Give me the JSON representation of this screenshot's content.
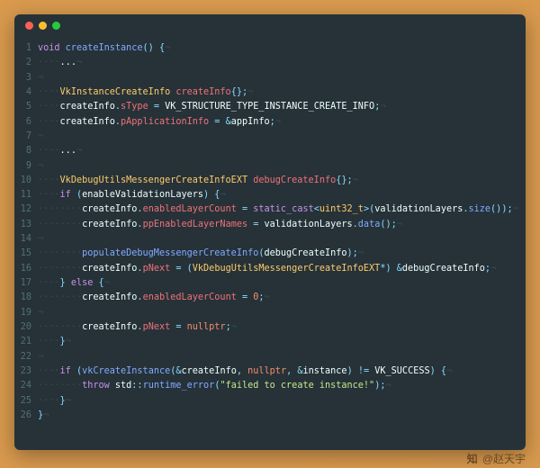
{
  "traffic_lights": {
    "red": "#ff5f56",
    "yellow": "#ffbd2e",
    "green": "#27c93f"
  },
  "code_bg": "#263238",
  "syntax": {
    "keyword": "#c792ea",
    "type": "#ffcb6b",
    "ident": "#eeffff",
    "func": "#82aaff",
    "param": "#f07178",
    "string": "#c3e88d",
    "number": "#f78c6c",
    "punct": "#89ddff",
    "op": "#89ddff",
    "const": "#eeffff",
    "null": "#f78c6c",
    "comment": "#546e7a",
    "invis": "#3a4a52"
  },
  "show_whitespace_dots": true,
  "show_eol_marker": true,
  "eol_marker": "¬",
  "dot_char": "·",
  "lines": [
    {
      "n": 1,
      "indent": 0,
      "tokens": [
        {
          "t": "void ",
          "c": "keyword"
        },
        {
          "t": "createInstance",
          "c": "func"
        },
        {
          "t": "() {",
          "c": "punct"
        }
      ]
    },
    {
      "n": 2,
      "indent": 1,
      "tokens": [
        {
          "t": "...",
          "c": "ident"
        }
      ]
    },
    {
      "n": 3,
      "indent": 0,
      "tokens": []
    },
    {
      "n": 4,
      "indent": 1,
      "tokens": [
        {
          "t": "VkInstanceCreateInfo ",
          "c": "type"
        },
        {
          "t": "createInfo",
          "c": "param"
        },
        {
          "t": "{};",
          "c": "punct"
        }
      ]
    },
    {
      "n": 5,
      "indent": 1,
      "tokens": [
        {
          "t": "createInfo",
          "c": "ident"
        },
        {
          "t": ".",
          "c": "punct"
        },
        {
          "t": "sType",
          "c": "param"
        },
        {
          "t": " = ",
          "c": "op"
        },
        {
          "t": "VK_STRUCTURE_TYPE_INSTANCE_CREATE_INFO",
          "c": "const"
        },
        {
          "t": ";",
          "c": "punct"
        }
      ]
    },
    {
      "n": 6,
      "indent": 1,
      "tokens": [
        {
          "t": "createInfo",
          "c": "ident"
        },
        {
          "t": ".",
          "c": "punct"
        },
        {
          "t": "pApplicationInfo",
          "c": "param"
        },
        {
          "t": " = ",
          "c": "op"
        },
        {
          "t": "&",
          "c": "op"
        },
        {
          "t": "appInfo",
          "c": "ident"
        },
        {
          "t": ";",
          "c": "punct"
        }
      ]
    },
    {
      "n": 7,
      "indent": 0,
      "tokens": []
    },
    {
      "n": 8,
      "indent": 1,
      "tokens": [
        {
          "t": "...",
          "c": "ident"
        }
      ]
    },
    {
      "n": 9,
      "indent": 0,
      "tokens": []
    },
    {
      "n": 10,
      "indent": 1,
      "tokens": [
        {
          "t": "VkDebugUtilsMessengerCreateInfoEXT ",
          "c": "type"
        },
        {
          "t": "debugCreateInfo",
          "c": "param"
        },
        {
          "t": "{};",
          "c": "punct"
        }
      ]
    },
    {
      "n": 11,
      "indent": 1,
      "tokens": [
        {
          "t": "if ",
          "c": "keyword"
        },
        {
          "t": "(",
          "c": "punct"
        },
        {
          "t": "enableValidationLayers",
          "c": "ident"
        },
        {
          "t": ") {",
          "c": "punct"
        }
      ]
    },
    {
      "n": 12,
      "indent": 2,
      "tokens": [
        {
          "t": "createInfo",
          "c": "ident"
        },
        {
          "t": ".",
          "c": "punct"
        },
        {
          "t": "enabledLayerCount",
          "c": "param"
        },
        {
          "t": " = ",
          "c": "op"
        },
        {
          "t": "static_cast",
          "c": "keyword"
        },
        {
          "t": "<",
          "c": "punct"
        },
        {
          "t": "uint32_t",
          "c": "type"
        },
        {
          "t": ">(",
          "c": "punct"
        },
        {
          "t": "validationLayers",
          "c": "ident"
        },
        {
          "t": ".",
          "c": "punct"
        },
        {
          "t": "size",
          "c": "func"
        },
        {
          "t": "());",
          "c": "punct"
        }
      ]
    },
    {
      "n": 13,
      "indent": 2,
      "tokens": [
        {
          "t": "createInfo",
          "c": "ident"
        },
        {
          "t": ".",
          "c": "punct"
        },
        {
          "t": "ppEnabledLayerNames",
          "c": "param"
        },
        {
          "t": " = ",
          "c": "op"
        },
        {
          "t": "validationLayers",
          "c": "ident"
        },
        {
          "t": ".",
          "c": "punct"
        },
        {
          "t": "data",
          "c": "func"
        },
        {
          "t": "();",
          "c": "punct"
        }
      ]
    },
    {
      "n": 14,
      "indent": 0,
      "tokens": []
    },
    {
      "n": 15,
      "indent": 2,
      "tokens": [
        {
          "t": "populateDebugMessengerCreateInfo",
          "c": "func"
        },
        {
          "t": "(",
          "c": "punct"
        },
        {
          "t": "debugCreateInfo",
          "c": "ident"
        },
        {
          "t": ");",
          "c": "punct"
        }
      ]
    },
    {
      "n": 16,
      "indent": 2,
      "tokens": [
        {
          "t": "createInfo",
          "c": "ident"
        },
        {
          "t": ".",
          "c": "punct"
        },
        {
          "t": "pNext",
          "c": "param"
        },
        {
          "t": " = ",
          "c": "op"
        },
        {
          "t": "(",
          "c": "punct"
        },
        {
          "t": "VkDebugUtilsMessengerCreateInfoEXT",
          "c": "type"
        },
        {
          "t": "*",
          "c": "op"
        },
        {
          "t": ") ",
          "c": "punct"
        },
        {
          "t": "&",
          "c": "op"
        },
        {
          "t": "debugCreateInfo",
          "c": "ident"
        },
        {
          "t": ";",
          "c": "punct"
        }
      ]
    },
    {
      "n": 17,
      "indent": 1,
      "tokens": [
        {
          "t": "} ",
          "c": "punct"
        },
        {
          "t": "else ",
          "c": "keyword"
        },
        {
          "t": "{",
          "c": "punct"
        }
      ]
    },
    {
      "n": 18,
      "indent": 2,
      "tokens": [
        {
          "t": "createInfo",
          "c": "ident"
        },
        {
          "t": ".",
          "c": "punct"
        },
        {
          "t": "enabledLayerCount",
          "c": "param"
        },
        {
          "t": " = ",
          "c": "op"
        },
        {
          "t": "0",
          "c": "number"
        },
        {
          "t": ";",
          "c": "punct"
        }
      ]
    },
    {
      "n": 19,
      "indent": 0,
      "tokens": []
    },
    {
      "n": 20,
      "indent": 2,
      "tokens": [
        {
          "t": "createInfo",
          "c": "ident"
        },
        {
          "t": ".",
          "c": "punct"
        },
        {
          "t": "pNext",
          "c": "param"
        },
        {
          "t": " = ",
          "c": "op"
        },
        {
          "t": "nullptr",
          "c": "null"
        },
        {
          "t": ";",
          "c": "punct"
        }
      ]
    },
    {
      "n": 21,
      "indent": 1,
      "tokens": [
        {
          "t": "}",
          "c": "punct"
        }
      ]
    },
    {
      "n": 22,
      "indent": 0,
      "tokens": []
    },
    {
      "n": 23,
      "indent": 1,
      "tokens": [
        {
          "t": "if ",
          "c": "keyword"
        },
        {
          "t": "(",
          "c": "punct"
        },
        {
          "t": "vkCreateInstance",
          "c": "func"
        },
        {
          "t": "(",
          "c": "punct"
        },
        {
          "t": "&",
          "c": "op"
        },
        {
          "t": "createInfo",
          "c": "ident"
        },
        {
          "t": ", ",
          "c": "punct"
        },
        {
          "t": "nullptr",
          "c": "null"
        },
        {
          "t": ", ",
          "c": "punct"
        },
        {
          "t": "&",
          "c": "op"
        },
        {
          "t": "instance",
          "c": "ident"
        },
        {
          "t": ") ",
          "c": "punct"
        },
        {
          "t": "!= ",
          "c": "op"
        },
        {
          "t": "VK_SUCCESS",
          "c": "const"
        },
        {
          "t": ") {",
          "c": "punct"
        }
      ]
    },
    {
      "n": 24,
      "indent": 2,
      "tokens": [
        {
          "t": "throw ",
          "c": "keyword"
        },
        {
          "t": "std",
          "c": "ident"
        },
        {
          "t": "::",
          "c": "punct"
        },
        {
          "t": "runtime_error",
          "c": "func"
        },
        {
          "t": "(",
          "c": "punct"
        },
        {
          "t": "\"failed to create instance!\"",
          "c": "string"
        },
        {
          "t": ");",
          "c": "punct"
        }
      ]
    },
    {
      "n": 25,
      "indent": 1,
      "tokens": [
        {
          "t": "}",
          "c": "punct"
        }
      ]
    },
    {
      "n": 26,
      "indent": 0,
      "tokens": [
        {
          "t": "}",
          "c": "punct"
        }
      ]
    }
  ],
  "footer": {
    "logo": "知",
    "author_label": "@赵天宇"
  },
  "attribution_url": "https://blog.csdn.net/zhaotianyu950323"
}
